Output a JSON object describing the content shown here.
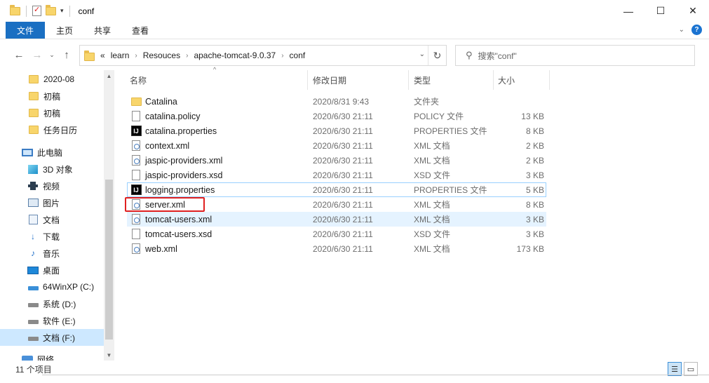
{
  "window": {
    "title": "conf",
    "controls": {
      "minimize": "—",
      "maximize": "☐",
      "close": "✕"
    }
  },
  "ribbon": {
    "tabs": [
      "文件",
      "主页",
      "共享",
      "查看"
    ],
    "expand_icon": "chevron-down-icon",
    "help": "?"
  },
  "address": {
    "prefix": "«",
    "crumbs": [
      "learn",
      "Resouces",
      "apache-tomcat-9.0.37",
      "conf"
    ],
    "search_placeholder": "搜索\"conf\""
  },
  "nav": {
    "items": [
      {
        "label": "2020-08",
        "icon": "folder-icon"
      },
      {
        "label": "初稿",
        "icon": "folder-icon"
      },
      {
        "label": "初稿",
        "icon": "folder-icon"
      },
      {
        "label": "任务日历",
        "icon": "folder-icon"
      },
      {
        "label": "此电脑",
        "icon": "computer-icon"
      },
      {
        "label": "3D 对象",
        "icon": "3d-objects-icon"
      },
      {
        "label": "视频",
        "icon": "video-icon"
      },
      {
        "label": "图片",
        "icon": "pictures-icon"
      },
      {
        "label": "文档",
        "icon": "documents-icon"
      },
      {
        "label": "下载",
        "icon": "download-icon"
      },
      {
        "label": "音乐",
        "icon": "music-icon"
      },
      {
        "label": "桌面",
        "icon": "desktop-icon"
      },
      {
        "label": "64WinXP  (C:)",
        "icon": "drive-icon"
      },
      {
        "label": "系统 (D:)",
        "icon": "drive-icon"
      },
      {
        "label": "软件 (E:)",
        "icon": "drive-icon"
      },
      {
        "label": "文档 (F:)",
        "icon": "drive-icon"
      },
      {
        "label": "网络",
        "icon": "network-icon"
      }
    ]
  },
  "columns": {
    "name": "名称",
    "date": "修改日期",
    "type": "类型",
    "size": "大小"
  },
  "files": [
    {
      "name": "Catalina",
      "date": "2020/8/31 9:43",
      "type": "文件夹",
      "size": "",
      "icon": "folder-icon"
    },
    {
      "name": "catalina.policy",
      "date": "2020/6/30 21:11",
      "type": "POLICY 文件",
      "size": "13 KB",
      "icon": "file-icon"
    },
    {
      "name": "catalina.properties",
      "date": "2020/6/30 21:11",
      "type": "PROPERTIES 文件",
      "size": "8 KB",
      "icon": "intellij-icon"
    },
    {
      "name": "context.xml",
      "date": "2020/6/30 21:11",
      "type": "XML 文档",
      "size": "2 KB",
      "icon": "xml-icon"
    },
    {
      "name": "jaspic-providers.xml",
      "date": "2020/6/30 21:11",
      "type": "XML 文档",
      "size": "2 KB",
      "icon": "xml-icon"
    },
    {
      "name": "jaspic-providers.xsd",
      "date": "2020/6/30 21:11",
      "type": "XSD 文件",
      "size": "3 KB",
      "icon": "file-icon"
    },
    {
      "name": "logging.properties",
      "date": "2020/6/30 21:11",
      "type": "PROPERTIES 文件",
      "size": "5 KB",
      "icon": "intellij-icon"
    },
    {
      "name": "server.xml",
      "date": "2020/6/30 21:11",
      "type": "XML 文档",
      "size": "8 KB",
      "icon": "xml-icon"
    },
    {
      "name": "tomcat-users.xml",
      "date": "2020/6/30 21:11",
      "type": "XML 文档",
      "size": "3 KB",
      "icon": "xml-icon"
    },
    {
      "name": "tomcat-users.xsd",
      "date": "2020/6/30 21:11",
      "type": "XSD 文件",
      "size": "3 KB",
      "icon": "file-icon"
    },
    {
      "name": "web.xml",
      "date": "2020/6/30 21:11",
      "type": "XML 文档",
      "size": "173 KB",
      "icon": "xml-icon"
    }
  ],
  "status": {
    "count": "11 个项目"
  },
  "colors": {
    "accent": "#1a6fc2",
    "highlight": "#e02020",
    "selection": "#cde8ff"
  }
}
